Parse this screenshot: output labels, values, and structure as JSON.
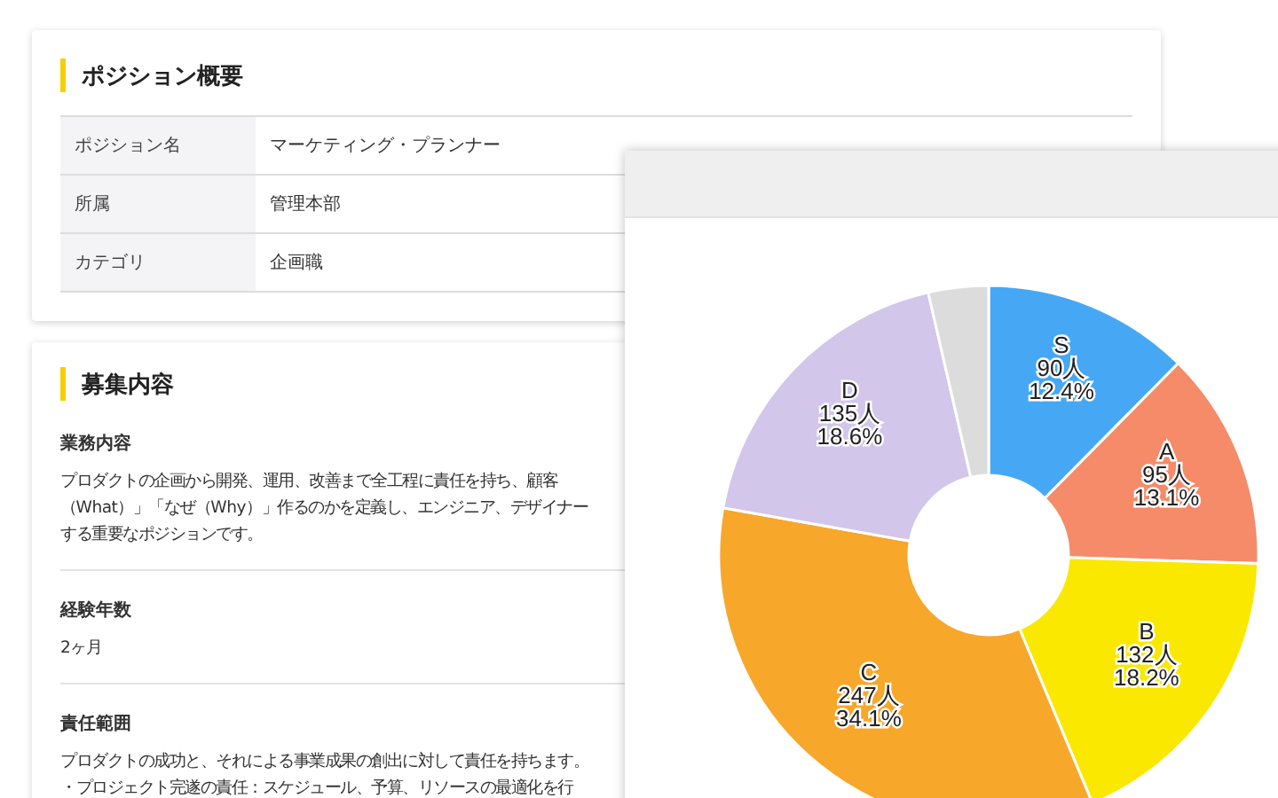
{
  "overview": {
    "title": "ポジション概要",
    "rows": [
      {
        "label": "ポジション名",
        "value": "マーケティング・プランナー"
      },
      {
        "label": "所属",
        "value": "管理本部"
      },
      {
        "label": "カテゴリ",
        "value": "企画職"
      }
    ]
  },
  "recruitment": {
    "title": "募集内容",
    "sections": [
      {
        "heading": "業務内容",
        "lines": [
          "プロダクトの企画から開発、運用、改善まで全工程に責任を持ち、顧客",
          "（What）」「なぜ（Why）」作るのかを定義し、エンジニア、デザイナー",
          "する重要なポジションです。"
        ]
      },
      {
        "heading": "経験年数",
        "lines": [
          "2ヶ月"
        ]
      },
      {
        "heading": "責任範囲",
        "lines": [
          "プロダクトの成功と、それによる事業成果の創出に対して責任を持ちます。",
          "・プロジェクト完遂の責任：スケジュール、予算、リソースの最適化を行"
        ]
      }
    ]
  },
  "chart_window": {
    "chart_data": {
      "type": "donut",
      "categories": [
        "S",
        "A",
        "B",
        "C",
        "D",
        null
      ],
      "values": [
        12.4,
        13.1,
        18.2,
        34.1,
        18.6,
        3.6
      ],
      "value_labels": [
        [
          "90人",
          "12.4%"
        ],
        [
          "95人",
          "13.1%"
        ],
        [
          "132人",
          "18.2%"
        ],
        [
          "247人",
          "34.1%"
        ],
        [
          "135人",
          "18.6%"
        ],
        null
      ],
      "colors": [
        "#46a8f5",
        "#f58b69",
        "#fae800",
        "#f7a72a",
        "#d2c6ea",
        "#dcdcdc"
      ]
    }
  }
}
